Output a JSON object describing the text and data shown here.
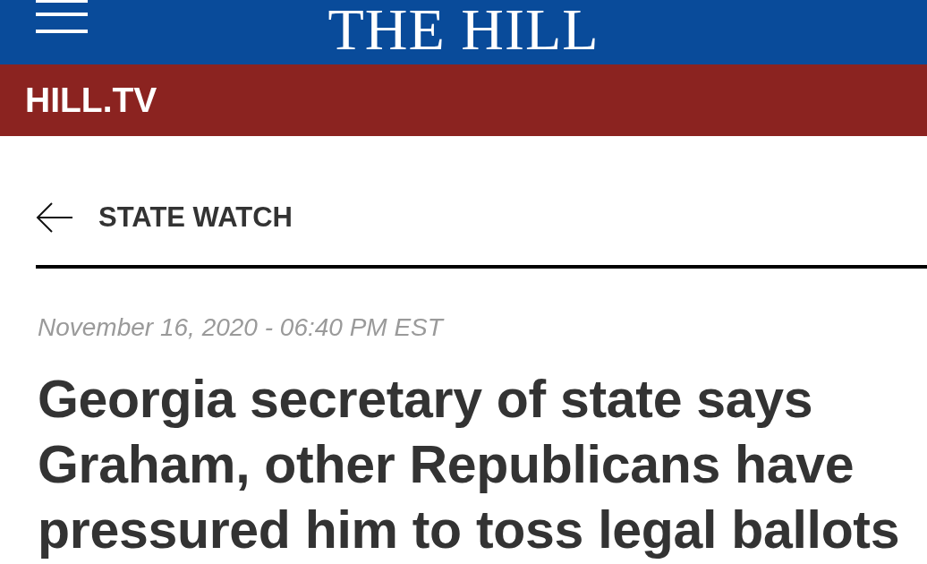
{
  "header": {
    "logo": "THE HILL"
  },
  "section_bar": {
    "label": "HILL.TV"
  },
  "breadcrumb": {
    "label": "STATE WATCH"
  },
  "article": {
    "timestamp": "November 16, 2020 - 06:40 PM EST",
    "headline": "Georgia secretary of state says Graham, other Republicans have pressured him to toss legal ballots"
  }
}
